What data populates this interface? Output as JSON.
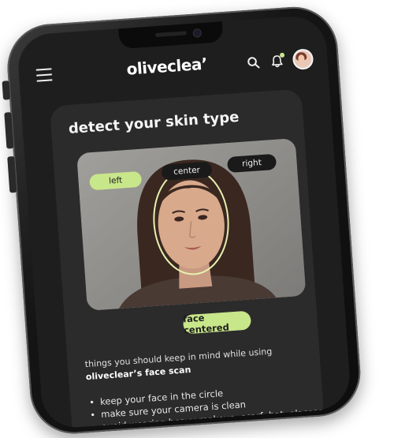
{
  "app": {
    "brand": "oliveclea’"
  },
  "scan": {
    "title": "detect your skin type",
    "angles": [
      "left",
      "center",
      "right"
    ],
    "selected_angle": "left",
    "status_badge": "face centered"
  },
  "tips": {
    "intro": "things you should keep in mind while using",
    "intro_bold": "oliveclear’s face scan",
    "items": [
      "keep your face in the circle",
      "make sure your camera is clean",
      "avoid wearing heavy makeup, scarf, hat, glasses, or any cosmetics ceply products or"
    ]
  },
  "colors": {
    "accent": "#c8e68a",
    "screen_bg": "#1e1e1e",
    "card_bg": "#2b2b2b"
  },
  "icons": {
    "menu": "hamburger-icon",
    "search": "search-icon",
    "notifications": "bell-icon",
    "profile": "avatar"
  }
}
